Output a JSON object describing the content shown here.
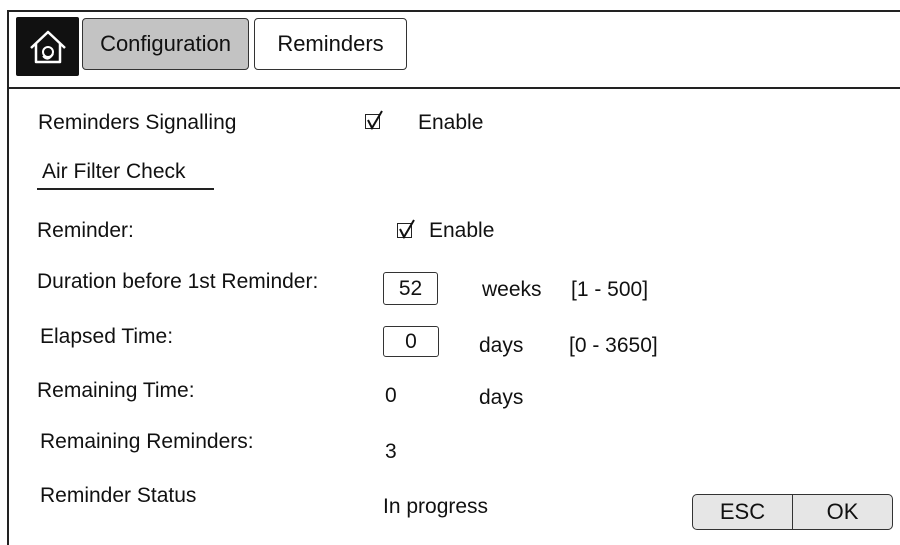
{
  "header": {
    "tabs": [
      {
        "label": "Configuration",
        "active": true
      },
      {
        "label": "Reminders",
        "active": false
      }
    ]
  },
  "signalling": {
    "label": "Reminders Signalling",
    "checked": true,
    "option": "Enable"
  },
  "section_title": "Air Filter Check",
  "reminder": {
    "label": "Reminder:",
    "checked": true,
    "option": "Enable"
  },
  "duration": {
    "label": "Duration before 1st Reminder:",
    "value": "52",
    "unit": "weeks",
    "range": "[1 - 500]"
  },
  "elapsed": {
    "label": "Elapsed Time:",
    "value": "0",
    "unit": "days",
    "range": "[0 - 3650]"
  },
  "remaining_time": {
    "label": "Remaining Time:",
    "value": "0",
    "unit": "days"
  },
  "remaining_reminders": {
    "label": "Remaining Reminders:",
    "value": "3"
  },
  "status": {
    "label": "Reminder Status",
    "value": "In progress"
  },
  "buttons": {
    "esc": "ESC",
    "ok": "OK"
  },
  "icons": {
    "home": "home-icon",
    "checkbox": "checkmark-icon"
  }
}
